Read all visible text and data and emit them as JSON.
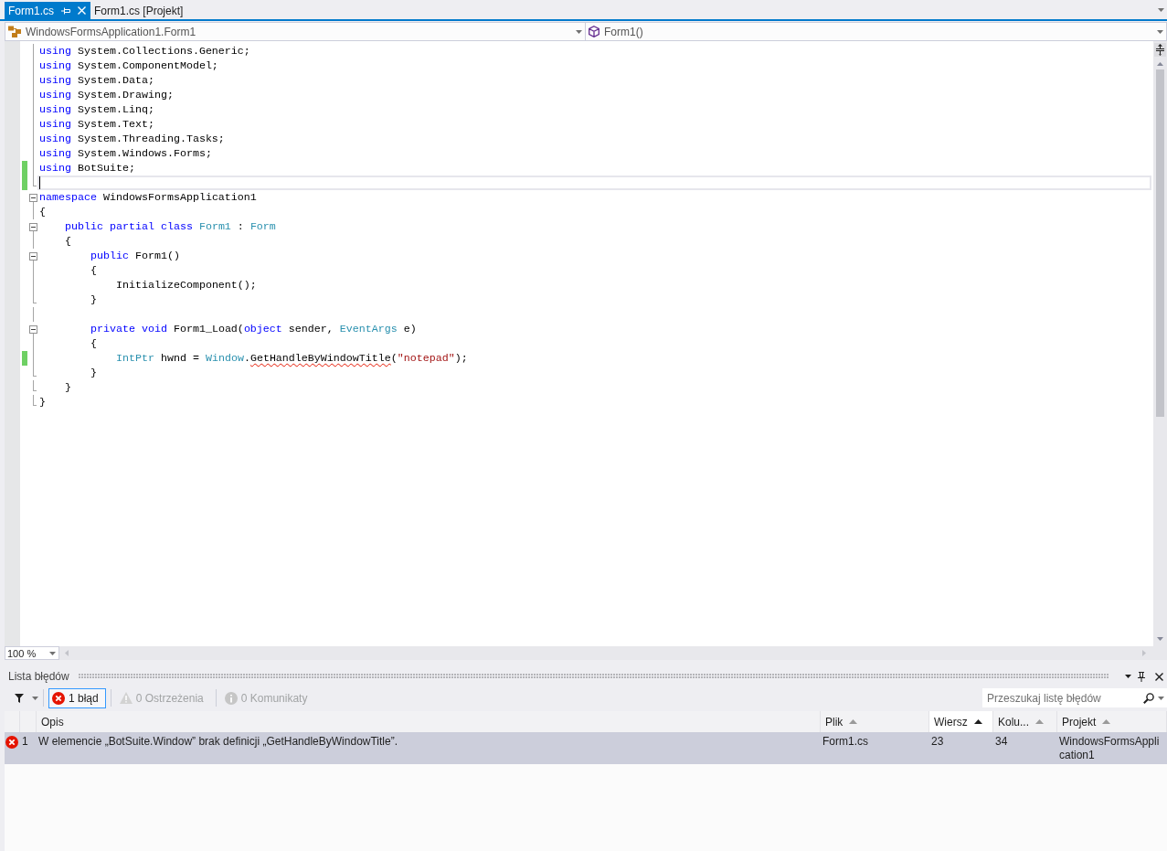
{
  "tabs": [
    {
      "label": "Form1.cs",
      "selected": true
    },
    {
      "label": "Form1.cs [Projekt]",
      "selected": false
    }
  ],
  "navigation_bar": {
    "type_dropdown": "WindowsFormsApplication1.Form1",
    "member_dropdown": "Form1()"
  },
  "editor": {
    "lines": [
      {
        "kind": "nested",
        "tokens": [
          {
            "kind": "keyword",
            "text": "using"
          },
          {
            "kind": "plain",
            "text": " System.Collections.Generic;"
          }
        ],
        "changed": false,
        "current": false
      },
      {
        "kind": "nested",
        "tokens": [
          {
            "kind": "keyword",
            "text": "using"
          },
          {
            "kind": "plain",
            "text": " System.ComponentModel;"
          }
        ],
        "changed": false,
        "current": false
      },
      {
        "kind": "nested",
        "tokens": [
          {
            "kind": "keyword",
            "text": "using"
          },
          {
            "kind": "plain",
            "text": " System.Data;"
          }
        ],
        "changed": false,
        "current": false
      },
      {
        "kind": "nested",
        "tokens": [
          {
            "kind": "keyword",
            "text": "using"
          },
          {
            "kind": "plain",
            "text": " System.Drawing;"
          }
        ],
        "changed": false,
        "current": false
      },
      {
        "kind": "nested",
        "tokens": [
          {
            "kind": "keyword",
            "text": "using"
          },
          {
            "kind": "plain",
            "text": " System.Linq;"
          }
        ],
        "changed": false,
        "current": false
      },
      {
        "kind": "nested",
        "tokens": [
          {
            "kind": "keyword",
            "text": "using"
          },
          {
            "kind": "plain",
            "text": " System.Text;"
          }
        ],
        "changed": false,
        "current": false
      },
      {
        "kind": "nested",
        "tokens": [
          {
            "kind": "keyword",
            "text": "using"
          },
          {
            "kind": "plain",
            "text": " System.Threading.Tasks;"
          }
        ],
        "changed": false,
        "current": false
      },
      {
        "kind": "nested",
        "tokens": [
          {
            "kind": "keyword",
            "text": "using"
          },
          {
            "kind": "plain",
            "text": " System.Windows.Forms;"
          }
        ],
        "changed": false,
        "current": false
      },
      {
        "kind": "nested",
        "tokens": [
          {
            "kind": "keyword",
            "text": "using"
          },
          {
            "kind": "plain",
            "text": " BotSuite;"
          }
        ],
        "changed": true,
        "current": false
      },
      {
        "kind": "closing",
        "changed": true,
        "current": true
      },
      {
        "kind": "collapsible",
        "tokens": [
          {
            "kind": "keyword",
            "text": "namespace"
          },
          {
            "kind": "plain",
            "text": " WindowsFormsApplication1"
          }
        ],
        "changed": false,
        "current": false
      },
      {
        "kind": "nested",
        "tokens": [
          {
            "kind": "plain",
            "text": "{"
          }
        ],
        "changed": false,
        "current": false
      },
      {
        "kind": "collapsible",
        "tokens": [
          {
            "kind": "keyword",
            "text": "    public partial class "
          },
          {
            "kind": "type",
            "text": "Form1"
          },
          {
            "kind": "plain",
            "text": " : "
          },
          {
            "kind": "type",
            "text": "Form"
          }
        ],
        "changed": false,
        "current": false
      },
      {
        "kind": "nested",
        "tokens": [
          {
            "kind": "plain",
            "text": "    {"
          }
        ],
        "changed": false,
        "current": false
      },
      {
        "kind": "collapsible",
        "tokens": [
          {
            "kind": "keyword",
            "text": "        public"
          },
          {
            "kind": "plain",
            "text": " Form1()"
          }
        ],
        "changed": false,
        "current": false
      },
      {
        "kind": "nested",
        "tokens": [
          {
            "kind": "plain",
            "text": "        {"
          }
        ],
        "changed": false,
        "current": false
      },
      {
        "kind": "nested",
        "tokens": [
          {
            "kind": "plain",
            "text": "            InitializeComponent();"
          }
        ],
        "changed": false,
        "current": false
      },
      {
        "kind": "closing",
        "tokens": [
          {
            "kind": "plain",
            "text": "        }"
          }
        ],
        "changed": false,
        "current": false
      },
      {
        "kind": "nested",
        "changed": false,
        "current": false
      },
      {
        "kind": "collapsible",
        "tokens": [
          {
            "kind": "keyword",
            "text": "        private void"
          },
          {
            "kind": "plain",
            "text": " Form1_Load("
          },
          {
            "kind": "keyword",
            "text": "object"
          },
          {
            "kind": "plain",
            "text": " sender, "
          },
          {
            "kind": "type",
            "text": "EventArgs"
          },
          {
            "kind": "plain",
            "text": " e)"
          }
        ],
        "changed": false,
        "current": false
      },
      {
        "kind": "nested",
        "tokens": [
          {
            "kind": "plain",
            "text": "        {"
          }
        ],
        "changed": false,
        "current": false
      },
      {
        "kind": "nested",
        "tokens": [
          {
            "kind": "type",
            "text": "            IntPtr"
          },
          {
            "kind": "plain",
            "text": " hwnd = "
          },
          {
            "kind": "type",
            "text": "Window"
          },
          {
            "kind": "plain",
            "text": "."
          },
          {
            "kind": "error",
            "text": "GetHandleByWindowTitle"
          },
          {
            "kind": "plain",
            "text": "("
          },
          {
            "kind": "string",
            "text": "\"notepad\""
          },
          {
            "kind": "plain",
            "text": ");"
          }
        ],
        "changed": true,
        "current": false
      },
      {
        "kind": "closing",
        "tokens": [
          {
            "kind": "plain",
            "text": "        }"
          }
        ],
        "changed": false,
        "current": false
      },
      {
        "kind": "closing",
        "tokens": [
          {
            "kind": "plain",
            "text": "    }"
          }
        ],
        "changed": false,
        "current": false
      },
      {
        "kind": "closing",
        "tokens": [
          {
            "kind": "plain",
            "text": "}"
          }
        ],
        "changed": false,
        "current": false
      }
    ],
    "zoom": "100 %"
  },
  "error_list": {
    "title": "Lista błędów",
    "filters": [
      {
        "kind": "error",
        "label": "1 błąd",
        "selected": true,
        "disabled": false
      },
      {
        "kind": "warning",
        "label": "0 Ostrzeżenia",
        "selected": false,
        "disabled": true
      },
      {
        "kind": "info",
        "label": "0 Komunikaty",
        "selected": false,
        "disabled": true
      }
    ],
    "search": {
      "placeholder": "Przeszukaj listę błędów"
    },
    "columns": [
      {
        "label": "Opis",
        "sortable": false,
        "sorted": false
      },
      {
        "label": "Plik",
        "sortable": true,
        "sorted": false
      },
      {
        "label": "Wiersz",
        "sortable": true,
        "sorted": true
      },
      {
        "label": "Kolu...",
        "sortable": true,
        "sorted": false
      },
      {
        "label": "Projekt",
        "sortable": true,
        "sorted": false
      }
    ],
    "rows": [
      {
        "kind": "error",
        "selected": true,
        "number": "1",
        "cells": [
          "W elemencie „BotSuite.Window” brak definicji „GetHandleByWindowTitle”.",
          "Form1.cs",
          "23",
          "34",
          "WindowsFormsApplication1"
        ]
      }
    ]
  }
}
